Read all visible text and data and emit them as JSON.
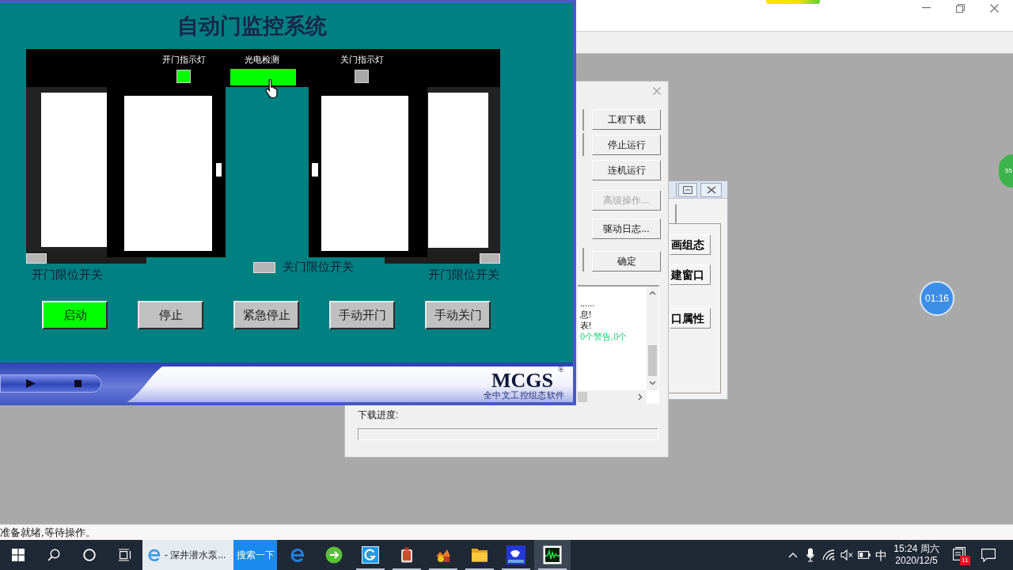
{
  "run_window": {
    "title": "自动门监控系统",
    "indicators": [
      {
        "label": "开门指示灯",
        "kind": "lamp",
        "on": true
      },
      {
        "label": "光电检测",
        "kind": "sensor",
        "on": true
      },
      {
        "label": "关门指示灯",
        "kind": "lamp",
        "on": false
      }
    ],
    "limit_switches": [
      {
        "label": "开门限位开关",
        "on": false
      },
      {
        "label": "关门限位开关",
        "on": false
      },
      {
        "label": "开门限位开关",
        "on": false
      }
    ],
    "buttons": [
      {
        "label": "启动",
        "on": true
      },
      {
        "label": "停止",
        "on": false
      },
      {
        "label": "紧急停止",
        "on": false
      },
      {
        "label": "手动开门",
        "on": false
      },
      {
        "label": "手动关门",
        "on": false
      }
    ],
    "brand": {
      "name": "MCGS",
      "mark": "®",
      "tagline": "全中文工控组态软件"
    }
  },
  "back_window": {
    "buttons": [
      "画组态",
      "建窗口",
      "口属性"
    ]
  },
  "download_dialog": {
    "buttons": [
      {
        "label": "工程下载",
        "disabled": false
      },
      {
        "label": "停止运行",
        "disabled": false
      },
      {
        "label": "连机运行",
        "disabled": false
      },
      {
        "label": "高级操作...",
        "disabled": true
      },
      {
        "label": "驱动日志...",
        "disabled": false
      },
      {
        "label": "确定",
        "disabled": false
      }
    ],
    "log_lines": [
      {
        "text": "......",
        "kind": "info"
      },
      {
        "text": "息!",
        "kind": "info"
      },
      {
        "text": "表!",
        "kind": "info"
      },
      {
        "text": "0个警告,0个",
        "kind": "result"
      }
    ],
    "progress": {
      "label": "下载进度:",
      "level": 0
    }
  },
  "timer_badges": [
    {
      "text": "55",
      "color": "#3cb44b"
    },
    {
      "text": "01:16",
      "color": "#3d8ee6"
    }
  ],
  "status_bar": {
    "text": "准备就绪,等待操作。"
  },
  "taskbar": {
    "task_button": {
      "label": "- 深井潜水泵..."
    },
    "search_button": "搜索一下",
    "apps": [
      {
        "kind": "e_logo",
        "running": false,
        "selected": false
      },
      {
        "kind": "round_app",
        "running": false,
        "selected": false
      },
      {
        "kind": "swirl_tile",
        "running": true,
        "selected": false
      },
      {
        "kind": "box_app",
        "running": true,
        "selected": false
      },
      {
        "kind": "figure",
        "running": true,
        "selected": false
      },
      {
        "kind": "folder",
        "running": true,
        "selected": false
      },
      {
        "kind": "mouse_tile",
        "running": true,
        "selected": false
      },
      {
        "kind": "waveform_monitor",
        "running": true,
        "selected": true
      }
    ],
    "tray": {
      "ime": "中",
      "time": "15:24 周六",
      "date": "2020/12/5",
      "notifications": "11"
    }
  }
}
